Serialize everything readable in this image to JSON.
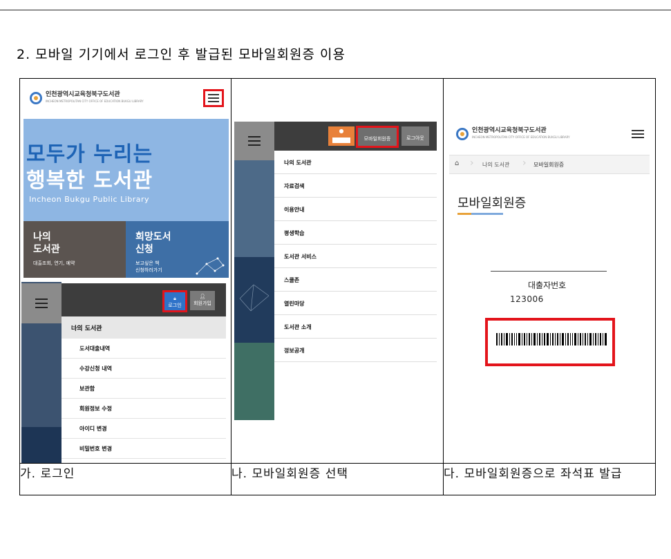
{
  "heading": "2. 모바일 기기에서 로그인 후 발급된 모바일회원증 이용",
  "library": {
    "name": "인천광역시교육청북구도서관",
    "name_en": "INCHEON METROPOLITAN CITY OFFICE OF EDUCATION BUKGU LIBRARY"
  },
  "panel1": {
    "hero_line1": "모두가 누리는",
    "hero_line2": "행복한 도서관",
    "hero_en": "Incheon Bukgu Public Library",
    "card1_title": "나의\n도서관",
    "card1_sub": "대출조회, 연기, 예약",
    "card2_title": "희망도서\n신청",
    "card2_sub": "보고싶은 책\n신청하러가기",
    "login_label": "로그인",
    "join_label": "회원가입",
    "section_label": "나의 도서관",
    "sub_items": [
      "도서대출내역",
      "수강신청 내역",
      "보관함",
      "회원정보 수정",
      "아이디 변경",
      "비밀번호 변경"
    ]
  },
  "panel2": {
    "mobile_card_label": "모바일회원증",
    "logout_label": "로그아웃",
    "menu_items": [
      "나의 도서관",
      "자료검색",
      "이용안내",
      "평생학습",
      "도서관 서비스",
      "스쿨존",
      "열린마당",
      "도서관 소개",
      "정보공개"
    ]
  },
  "panel3": {
    "crumb_1": "나의 도서관",
    "crumb_2": "모바일회원증",
    "title": "모바일회원증",
    "label": "대출자번호",
    "number": "123006"
  },
  "captions": [
    "가. 로그인",
    "나. 모바일회원증 선택",
    "다. 모바일회원증으로 좌석표 발급"
  ],
  "colors": {
    "highlight_red": "#e3141b",
    "hero_blue": "#8eb6e3",
    "brand_blue": "#2f73c9",
    "header_dark": "#3d3d3d"
  }
}
